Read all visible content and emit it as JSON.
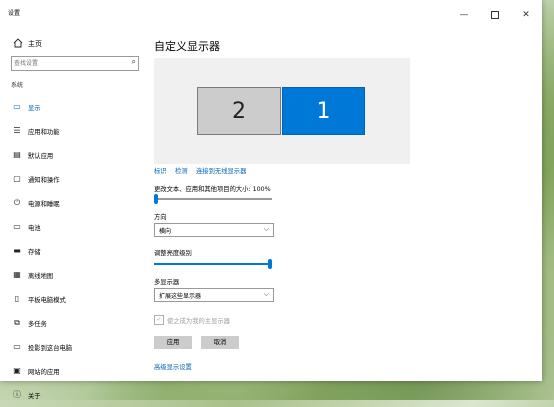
{
  "window": {
    "title": "设置"
  },
  "titlebar": {
    "minimize": "—",
    "close": "✕"
  },
  "sidebar": {
    "home_label": "主页",
    "search_placeholder": "查找设置",
    "group_label": "系统",
    "items": [
      {
        "label": "显示",
        "icon": "monitor-icon",
        "active": true
      },
      {
        "label": "应用和功能",
        "icon": "apps-list-icon"
      },
      {
        "label": "默认应用",
        "icon": "default-apps-icon"
      },
      {
        "label": "通知和操作",
        "icon": "notification-icon"
      },
      {
        "label": "电源和睡眠",
        "icon": "power-icon"
      },
      {
        "label": "电池",
        "icon": "battery-icon"
      },
      {
        "label": "存储",
        "icon": "storage-icon"
      },
      {
        "label": "离线地图",
        "icon": "map-icon"
      },
      {
        "label": "平板电脑模式",
        "icon": "tablet-icon"
      },
      {
        "label": "多任务",
        "icon": "multitask-icon"
      },
      {
        "label": "投影到这台电脑",
        "icon": "project-icon"
      },
      {
        "label": "网站的应用",
        "icon": "web-apps-icon"
      },
      {
        "label": "关于",
        "icon": "info-icon"
      }
    ]
  },
  "content": {
    "title": "自定义显示器",
    "monitors": {
      "secondary": "2",
      "primary": "1"
    },
    "links": {
      "identify": "标识",
      "detect": "检测",
      "wireless": "连接到无线显示器"
    },
    "scale_label": "更改文本、应用和其他项目的大小: 100%",
    "scale_fraction": 0.0,
    "orientation_label": "方向",
    "orientation_value": "横向",
    "brightness_label": "调整亮度级别",
    "brightness_fraction": 1.0,
    "multi_display_label": "多显示器",
    "multi_display_value": "扩展这些显示器",
    "main_display_label": "使之成为我的主显示器",
    "apply_label": "应用",
    "cancel_label": "取消",
    "advanced_link": "高级显示设置"
  },
  "colors": {
    "accent": "#0078d7",
    "monitor_inactive": "#cccccc",
    "monitor_area": "#f0f0f0"
  }
}
